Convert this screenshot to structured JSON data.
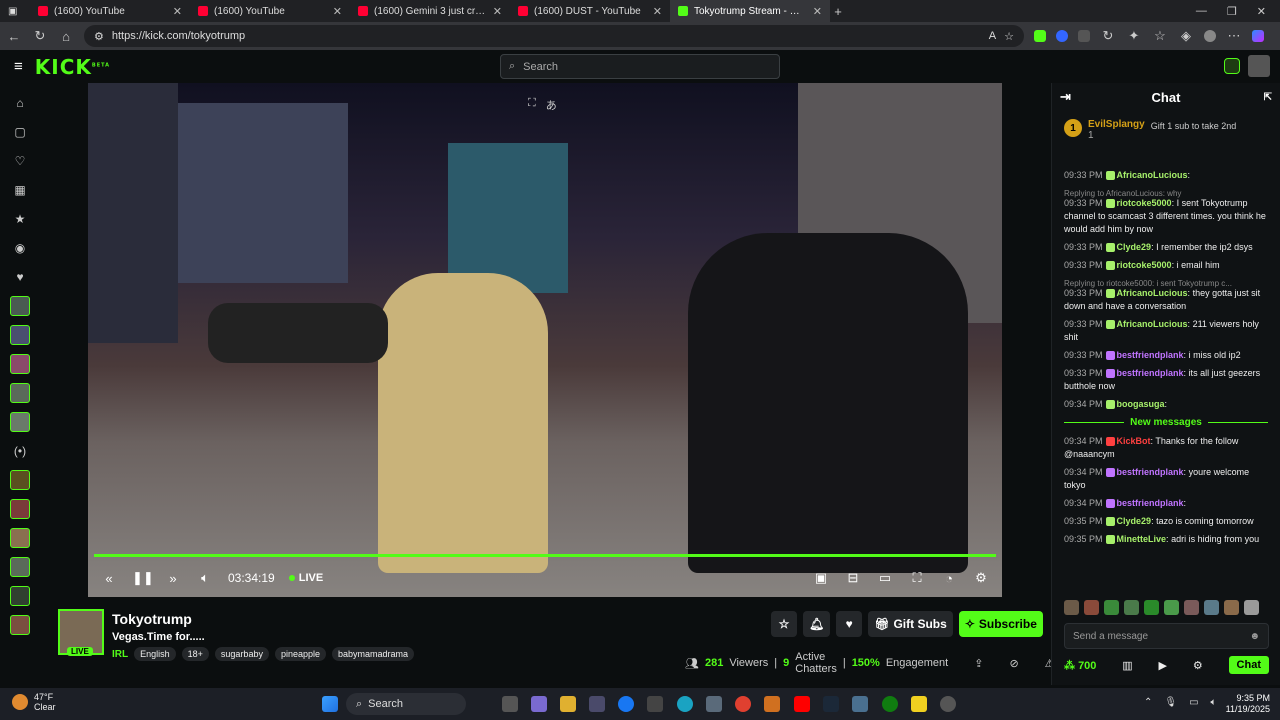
{
  "browser": {
    "tabs": [
      {
        "title": "(1600) YouTube",
        "color": "#ff0033"
      },
      {
        "title": "(1600) YouTube",
        "color": "#ff0033"
      },
      {
        "title": "(1600) Gemini 3 just crushed eve",
        "color": "#ff0033"
      },
      {
        "title": "(1600) DUST - YouTube",
        "color": "#ff0033"
      },
      {
        "title": "Tokyotrump Stream - Watch",
        "color": "#53fc18"
      }
    ],
    "url": "https://kick.com/tokyotrump"
  },
  "kick": {
    "logo": "KICK",
    "logo_badge": "BETA",
    "search_placeholder": "Search"
  },
  "player": {
    "time": "03:34:19",
    "live_label": "LIVE"
  },
  "stream": {
    "name": "Tokyotrump",
    "title": "Vegas.Time for.....",
    "category": "IRL",
    "tags": [
      "English",
      "18+",
      "sugarbaby",
      "pineapple",
      "babymamadrama"
    ],
    "live_pill": "LIVE",
    "gift_label": "Gift Subs",
    "subscribe_label": "Subscribe",
    "viewers": "281",
    "viewers_label": "Viewers",
    "chatters": "9",
    "chatters_label": "Active Chatters",
    "engagement": "150%",
    "engagement_label": "Engagement"
  },
  "chat": {
    "title": "Chat",
    "pinned_user": "EvilSplangy",
    "pinned_rank": "1",
    "pinned_sub": "1",
    "pinned_action": "Gift 1 sub to take 2nd",
    "messages": [
      {
        "time": "09:33 PM",
        "user": "AfricanoLucious",
        "color": "#a7f06b",
        "text": "",
        "reply": ""
      },
      {
        "time": "09:33 PM",
        "user": "riotcoke5000",
        "color": "#a7f06b",
        "text": "I sent Tokyotrump channel to scamcast 3 different times. you think he would add him by now",
        "reply": "Replying to AfricanoLucious: why"
      },
      {
        "time": "09:33 PM",
        "user": "Clyde29",
        "color": "#a7f06b",
        "text": "I remember the ip2 dsys",
        "reply": ""
      },
      {
        "time": "09:33 PM",
        "user": "riotcoke5000",
        "color": "#a7f06b",
        "text": "i email him",
        "reply": ""
      },
      {
        "time": "09:33 PM",
        "user": "AfricanoLucious",
        "color": "#a7f06b",
        "text": "they gotta just sit down and have a conversation",
        "reply": "Replying to riotcoke5000: i sent Tokyotrump c..."
      },
      {
        "time": "09:33 PM",
        "user": "AfricanoLucious",
        "color": "#a7f06b",
        "text": "211 viewers holy shit",
        "reply": ""
      },
      {
        "time": "09:33 PM",
        "user": "bestfriendplank",
        "color": "#c074ff",
        "text": "i miss old ip2",
        "reply": ""
      },
      {
        "time": "09:33 PM",
        "user": "bestfriendplank",
        "color": "#c074ff",
        "text": "its all just geezers butthole now",
        "reply": ""
      },
      {
        "time": "09:34 PM",
        "user": "boogasuga",
        "color": "#a7f06b",
        "text": "",
        "reply": ""
      }
    ],
    "new_messages_label": "New messages",
    "new_messages": [
      {
        "time": "09:34 PM",
        "user": "KickBot",
        "color": "#ff4040",
        "text": "Thanks for the follow @naaancym"
      },
      {
        "time": "09:34 PM",
        "user": "bestfriendplank",
        "color": "#c074ff",
        "text": "youre welcome tokyo"
      },
      {
        "time": "09:34 PM",
        "user": "bestfriendplank",
        "color": "#c074ff",
        "text": ""
      },
      {
        "time": "09:35 PM",
        "user": "Clyde29",
        "color": "#a7f06b",
        "text": "tazo is coming tomorrow"
      },
      {
        "time": "09:35 PM",
        "user": "MinetteLive",
        "color": "#a7f06b",
        "text": "adri is hiding from you"
      }
    ],
    "input_placeholder": "Send a message",
    "points": "700",
    "chat_button": "Chat"
  },
  "taskbar": {
    "temp": "47°F",
    "weather": "Clear",
    "search": "Search",
    "time": "9:35 PM",
    "date": "11/19/2025"
  }
}
